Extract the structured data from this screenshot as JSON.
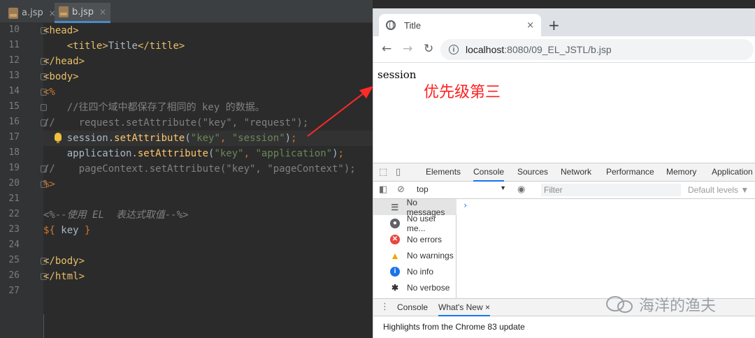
{
  "ide": {
    "tabs": [
      {
        "label": "a.jsp",
        "close": "×"
      },
      {
        "label": "b.jsp",
        "close": "×"
      }
    ],
    "line_numbers": [
      "10",
      "11",
      "12",
      "13",
      "14",
      "15",
      "16",
      "17",
      "18",
      "19",
      "20",
      "21",
      "22",
      "23",
      "24",
      "25",
      "26",
      "27"
    ],
    "code": {
      "l10_tag": "head",
      "l11_tag": "title",
      "l11_text": "Title",
      "l12_tag": "head",
      "l13_tag": "body",
      "l14_open": "<%",
      "l15_comment": "    //往四个域中都保存了相同的 key 的数据。",
      "l16_comment": "//    request.setAttribute(\"key\", \"request\");",
      "l17_obj": "session",
      "l17_method": "setAttribute",
      "l17_arg1": "\"key\"",
      "l17_arg2": "\"session\"",
      "l18_obj": "application",
      "l18_method": "setAttribute",
      "l18_arg1": "\"key\"",
      "l18_arg2": "\"application\"",
      "l19_comment": "//    pageContext.setAttribute(\"key\", \"pageContext\");",
      "l20_close": "%>",
      "l22_comment": "<%--使用 EL  表达式取值--%>",
      "l23_open": "${",
      "l23_key": " key ",
      "l23_close": "}",
      "l25_tag": "body",
      "l26_tag": "html"
    }
  },
  "browser": {
    "tab_title": "Title",
    "tab_close": "×",
    "new_tab": "+",
    "back": "←",
    "forward": "→",
    "reload": "↻",
    "url_host": "localhost",
    "url_port": ":8080",
    "url_path": "/09_EL_JSTL/b.jsp",
    "page_text": "session",
    "annotation": "优先级第三"
  },
  "devtools": {
    "tabs": [
      "Elements",
      "Console",
      "Sources",
      "Network",
      "Performance",
      "Memory",
      "Application"
    ],
    "active_tab": "Console",
    "context": "top",
    "filter_placeholder": "Filter",
    "levels": "Default levels ▼",
    "sidebar": [
      {
        "label": "No messages",
        "icon": "list-icon"
      },
      {
        "label": "No user me...",
        "icon": "user-icon"
      },
      {
        "label": "No errors",
        "icon": "error-icon",
        "color": "#e8473f"
      },
      {
        "label": "No warnings",
        "icon": "warning-icon",
        "color": "#f2a600"
      },
      {
        "label": "No info",
        "icon": "info-icon",
        "color": "#1a73e8"
      },
      {
        "label": "No verbose",
        "icon": "bug-icon"
      }
    ],
    "prompt": "›",
    "drawer_tabs": [
      "Console",
      "What's New"
    ],
    "drawer_close": "×",
    "drawer_message": "Highlights from the Chrome 83 update"
  },
  "watermark": {
    "text": "海洋的渔夫"
  }
}
